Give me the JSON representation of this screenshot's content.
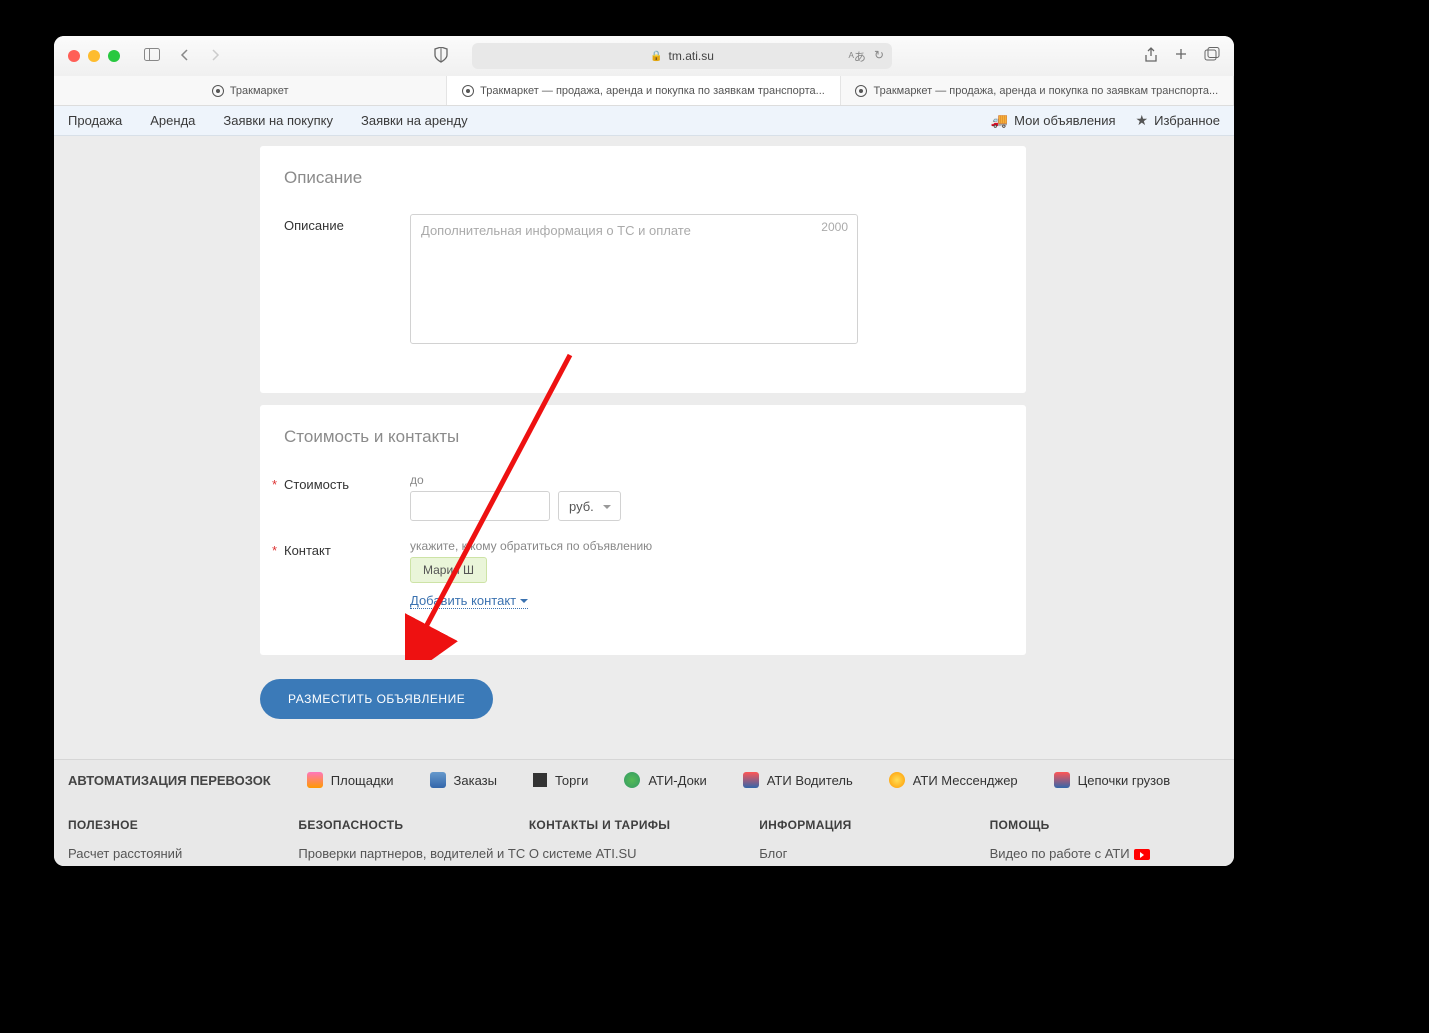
{
  "browser": {
    "url": "tm.ati.su",
    "tabs": [
      {
        "label": "Тракмаркет"
      },
      {
        "label": "Тракмаркет — продажа, аренда и покупка по заявкам транспорта..."
      },
      {
        "label": "Тракмаркет — продажа, аренда и покупка по заявкам транспорта..."
      }
    ]
  },
  "nav": {
    "items": [
      "Продажа",
      "Аренда",
      "Заявки на покупку",
      "Заявки на аренду"
    ],
    "my_ads": "Мои объявления",
    "favorites": "Избранное"
  },
  "section_description": {
    "title": "Описание",
    "label": "Описание",
    "placeholder": "Дополнительная информация о ТС и оплате",
    "char_count": "2000"
  },
  "section_price": {
    "title": "Стоимость и контакты",
    "price_label": "Стоимость",
    "price_hint": "до",
    "currency": "руб.",
    "contact_label": "Контакт",
    "contact_hint": "укажите, к кому обратиться по объявлению",
    "contact_chip": "Мария Ш",
    "add_contact": "Добавить контакт"
  },
  "submit_label": "РАЗМЕСТИТЬ ОБЪЯВЛЕНИЕ",
  "footer_strip": {
    "heading": "АВТОМАТИЗАЦИЯ ПЕРЕВОЗОК",
    "items": [
      "Площадки",
      "Заказы",
      "Торги",
      "АТИ-Доки",
      "АТИ Водитель",
      "АТИ Мессенджер",
      "Цепочки грузов"
    ]
  },
  "footer_cols": {
    "useful": {
      "title": "ПОЛЕЗНОЕ",
      "links": [
        "Расчет расстояний"
      ]
    },
    "security": {
      "title": "БЕЗОПАСНОСТЬ",
      "links": [
        "Проверки партнеров, водителей и ТС"
      ]
    },
    "contacts": {
      "title": "КОНТАКТЫ И ТАРИФЫ",
      "links": [
        "О системе ATI.SU"
      ]
    },
    "info": {
      "title": "ИНФОРМАЦИЯ",
      "links": [
        "Блог"
      ]
    },
    "help": {
      "title": "ПОМОЩЬ",
      "links": [
        "Видео по работе с АТИ"
      ]
    }
  }
}
